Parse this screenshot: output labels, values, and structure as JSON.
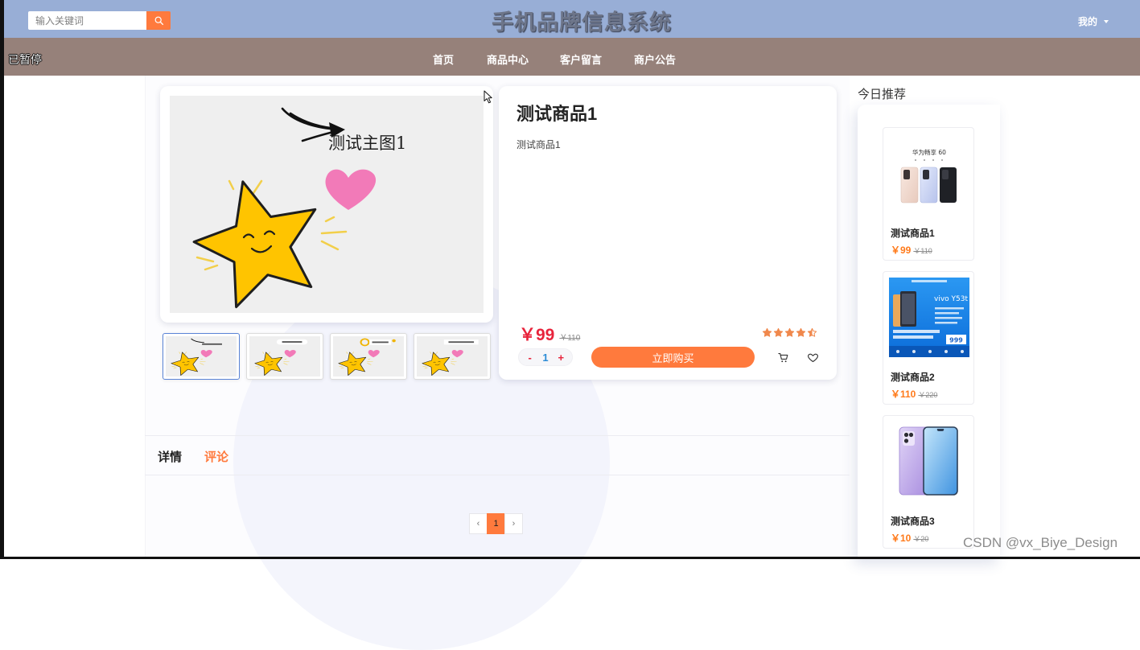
{
  "header": {
    "search": {
      "placeholder": "输入关键词",
      "value": ""
    },
    "title": "手机品牌信息系统",
    "user_menu": "我的"
  },
  "nav": {
    "status": "已暂停",
    "items": [
      {
        "label": "首页"
      },
      {
        "label": "商品中心"
      },
      {
        "label": "客户留言"
      },
      {
        "label": "商户公告"
      }
    ]
  },
  "product": {
    "image_caption": "测试主图1",
    "thumbnails": [
      {
        "selected": true
      },
      {
        "selected": false
      },
      {
        "selected": false
      },
      {
        "selected": false
      }
    ],
    "name": "测试商品1",
    "description": "测试商品1",
    "price": "￥99",
    "original_price": "￥110",
    "rating": 4.5,
    "quantity": {
      "minus": "-",
      "value": "1",
      "plus": "+"
    },
    "buy_label": "立即购买"
  },
  "recommend": {
    "title": "今日推荐",
    "items": [
      {
        "name": "测试商品1",
        "price": "￥99",
        "original_price": "￥110",
        "image_text": "华为畅享 60"
      },
      {
        "name": "测试商品2",
        "price": "￥110",
        "original_price": "￥220",
        "image_text": "vivo Y53t",
        "image_badge": "999"
      },
      {
        "name": "测试商品3",
        "price": "￥10",
        "original_price": "￥20"
      }
    ]
  },
  "tabs": [
    {
      "label": "详情",
      "active": false
    },
    {
      "label": "评论",
      "active": true
    }
  ],
  "pagination": {
    "prev": "‹",
    "current": "1",
    "next": "›"
  },
  "watermark": "CSDN @vx_Biye_Design",
  "colors": {
    "header_bg": "#98aed6",
    "nav_bg": "#96817a",
    "accent": "#ff7a3d",
    "price": "#e8243c",
    "rating": "#f0884c"
  },
  "icons": {
    "search": "search-icon",
    "user_dropdown": "caret-down-icon",
    "cart": "cart-icon",
    "favorite": "heart-icon",
    "rating": "star-icon",
    "pointer": "cursor-icon"
  }
}
